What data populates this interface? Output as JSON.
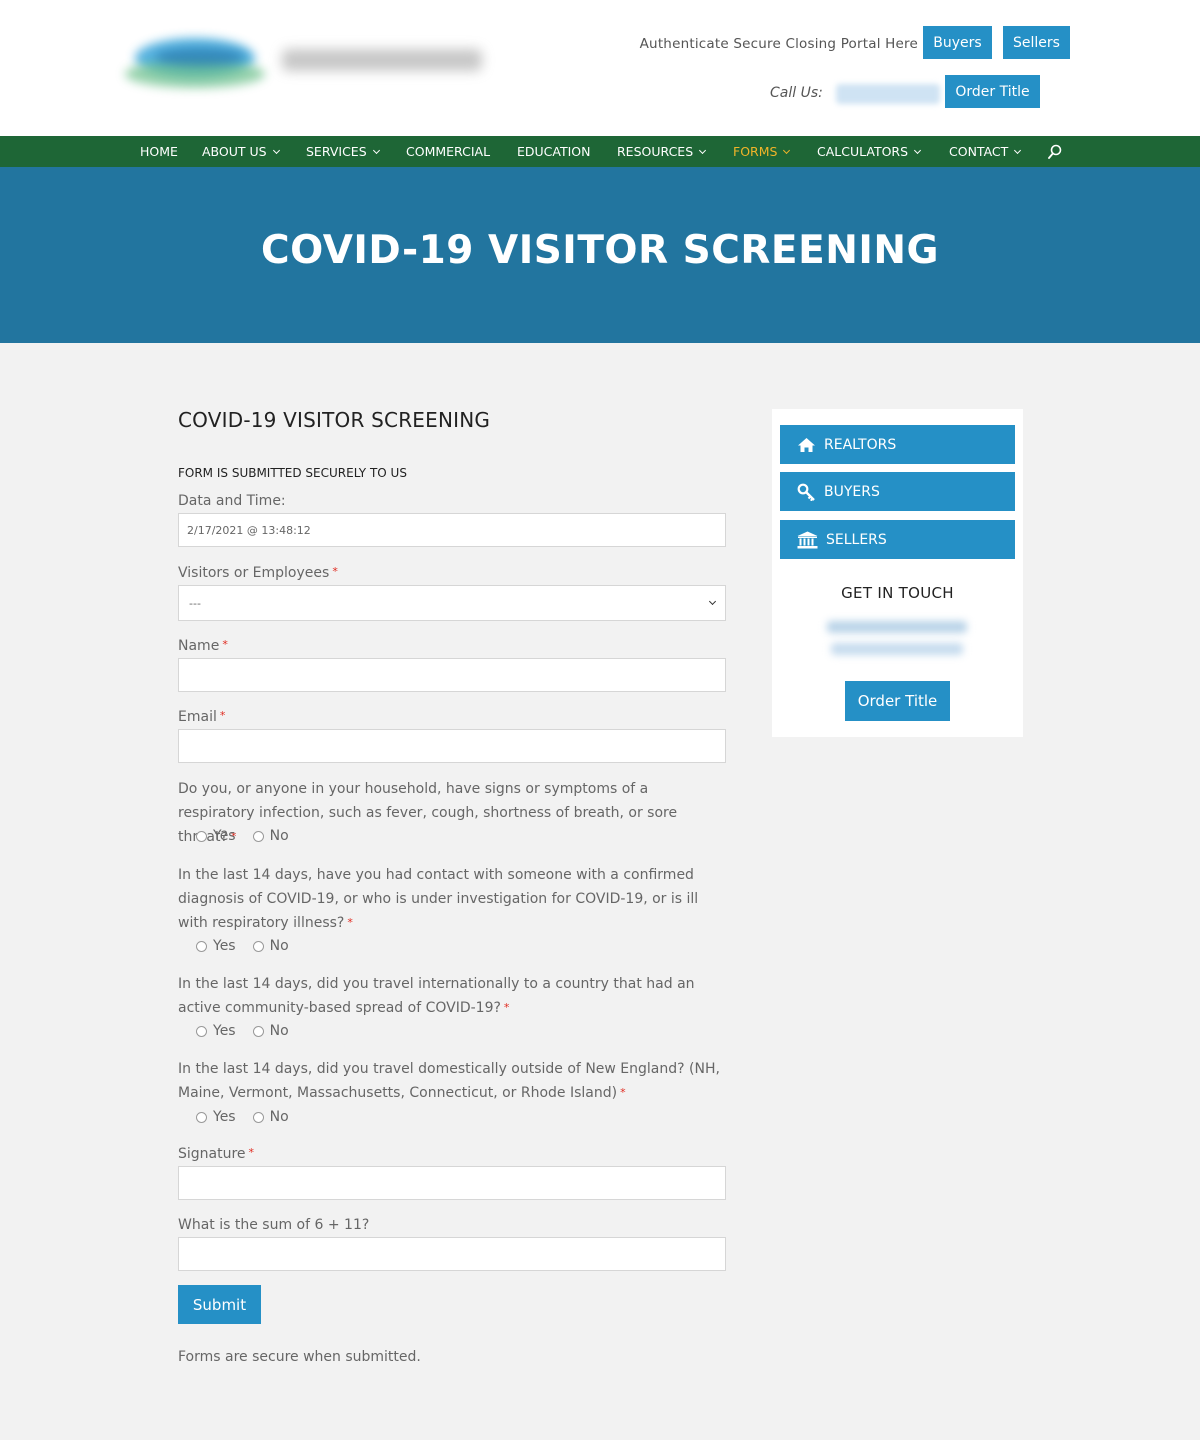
{
  "header": {
    "portal_text": "Authenticate Secure Closing Portal Here",
    "buyers_label": "Buyers",
    "sellers_label": "Sellers",
    "call_us_label": "Call Us:",
    "order_title_label": "Order Title"
  },
  "nav": {
    "items": [
      {
        "label": "HOME"
      },
      {
        "label": "ABOUT US"
      },
      {
        "label": "SERVICES"
      },
      {
        "label": "COMMERCIAL"
      },
      {
        "label": "EDUCATION"
      },
      {
        "label": "RESOURCES"
      },
      {
        "label": "FORMS"
      },
      {
        "label": "CALCULATORS"
      },
      {
        "label": "CONTACT"
      }
    ],
    "active_item": "FORMS",
    "active_color": "#f0b429"
  },
  "banner": {
    "title": "COVID-19 VISITOR SCREENING"
  },
  "form": {
    "title": "COVID-19 VISITOR SCREENING",
    "subtitle": "FORM IS SUBMITTED SECURELY TO US",
    "datetime_label": "Data and Time:",
    "datetime_value": "2/17/2021 @ 13:48:12",
    "visitors_label": "Visitors or Employees",
    "visitors_selected": "---",
    "name_label": "Name",
    "email_label": "Email",
    "required_mark": "*",
    "yes_label": "Yes",
    "no_label": "No",
    "questions": [
      "Do you, or anyone in your household, have signs or symptoms of a respiratory infection, such as fever, cough, shortness of breath, or sore throat?",
      "In the last 14 days, have you had contact with someone with a confirmed diagnosis of COVID-19, or who is under investigation for COVID-19, or is ill with respiratory illness?",
      "In the last 14 days, did you travel internationally to a country that had an active community-based spread of COVID-19?",
      "In the last 14 days, did you travel domestically outside of New England? (NH, Maine, Vermont, Massachusetts, Connecticut, or Rhode Island)"
    ],
    "signature_label": "Signature",
    "captcha_label": "What is the sum of 6 + 11?",
    "submit_label": "Submit",
    "footnote": "Forms are secure when submitted."
  },
  "sidebar": {
    "realtors_label": "REALTORS",
    "buyers_label": "BUYERS",
    "sellers_label": "SELLERS",
    "get_in_touch": "GET IN TOUCH",
    "order_title_label": "Order Title"
  },
  "colors": {
    "brand_blue": "#2590c6",
    "nav_green": "#1e6636",
    "banner_blue": "#22759f",
    "required_red": "#e02b20"
  }
}
